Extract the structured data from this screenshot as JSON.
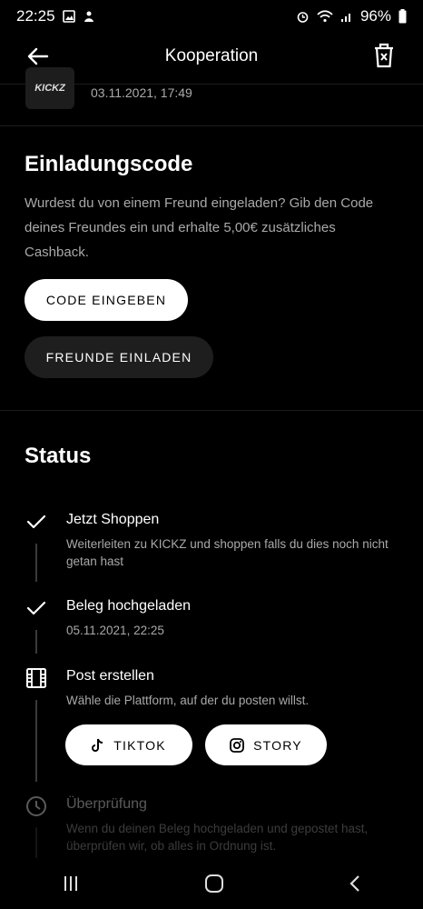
{
  "status_bar": {
    "time": "22:25",
    "battery": "96%"
  },
  "header": {
    "title": "Kooperation"
  },
  "partner": {
    "logo_text": "KICKZ",
    "date": "03.11.2021, 17:49"
  },
  "invite": {
    "title": "Einladungscode",
    "description": "Wurdest du von einem Freund eingeladen? Gib den Code deines Freundes ein und erhalte 5,00€ zusätzliches Cashback.",
    "enter_code_label": "CODE EINGEBEN",
    "invite_friends_label": "FREUNDE EINLADEN"
  },
  "status": {
    "title": "Status",
    "steps": [
      {
        "title": "Jetzt Shoppen",
        "subtitle": "Weiterleiten zu KICKZ und shoppen falls du dies noch nicht getan hast",
        "icon": "check-icon"
      },
      {
        "title": "Beleg hochgeladen",
        "subtitle": "05.11.2021, 22:25",
        "icon": "check-icon"
      },
      {
        "title": "Post erstellen",
        "subtitle": "Wähle die Plattform, auf der du posten willst.",
        "icon": "film-icon",
        "buttons": {
          "tiktok": "TIKTOK",
          "story": "STORY"
        }
      },
      {
        "title": "Überprüfung",
        "subtitle": "Wenn du deinen Beleg hochgeladen und gepostet hast, überprüfen wir, ob alles in Ordnung ist.",
        "icon": "clock-icon"
      }
    ]
  },
  "colors": {
    "background": "#000000",
    "button_light": "#ffffff",
    "button_dark": "#1e1e1e",
    "muted_text": "#a9a9a9"
  }
}
